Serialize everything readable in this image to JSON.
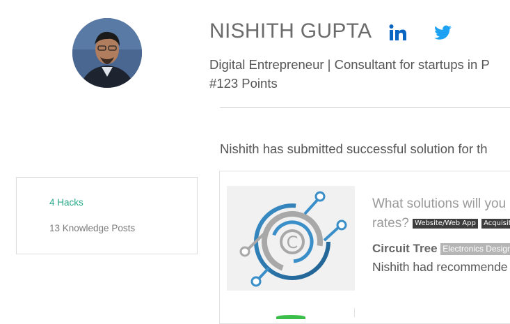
{
  "profile": {
    "name": "NISHITH GUPTA",
    "tagline": "Digital Entrepreneur | Consultant for startups in P",
    "points": "#123 Points"
  },
  "social": {
    "linkedin_icon": "linkedin-icon",
    "twitter_icon": "twitter-icon",
    "linkedin_color": "#0a66c2",
    "twitter_color": "#1da1f2"
  },
  "activity": {
    "submitted_text": "Nishith has submitted successful solution for th"
  },
  "stats": {
    "hacks": "4 Hacks",
    "knowledge_posts": "13 Knowledge Posts"
  },
  "hack_card": {
    "question_line1": "What solutions will you",
    "question_line2": "rates?",
    "tags": [
      "Website/Web App",
      "Acquisition"
    ],
    "solution_name": "Circuit Tree",
    "solution_category": "Electronics Design",
    "recommendation": "Nishith had recommende"
  },
  "colors": {
    "accent_green": "#2aa889",
    "text_gray": "#555555"
  }
}
